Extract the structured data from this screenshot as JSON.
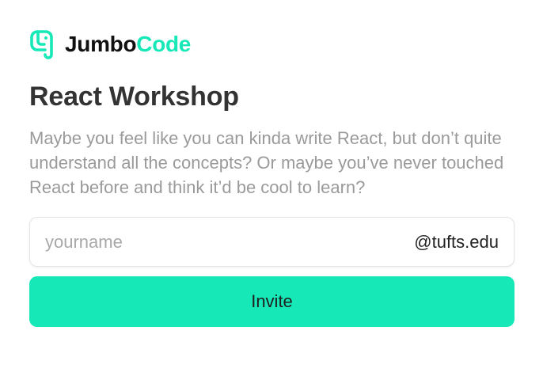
{
  "brand": {
    "name_part1": "Jumbo",
    "name_part2": "Code",
    "accent_color": "#16e8b7",
    "icon": "elephant-icon"
  },
  "workshop": {
    "title": "React Workshop",
    "description": "Maybe you feel like you can kinda write React, but don’t quite understand all the concepts? Or maybe you’ve never touched React before and think it’d be cool to learn?"
  },
  "signup": {
    "placeholder": "yourname",
    "value": "",
    "domain_suffix": "@tufts.edu",
    "button_label": "Invite"
  }
}
